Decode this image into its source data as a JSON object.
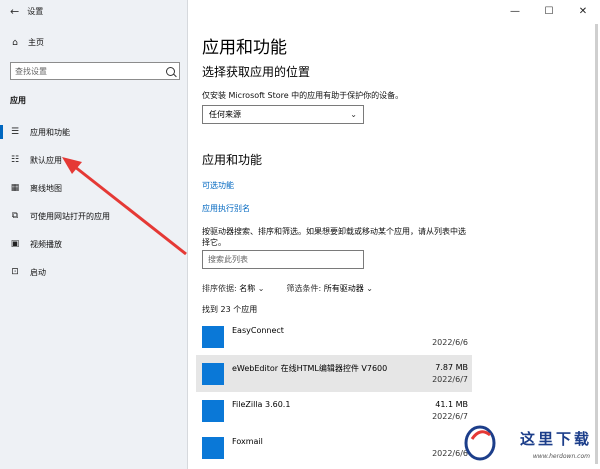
{
  "window": {
    "title": "设置",
    "controls": {
      "minimize": "—",
      "maximize": "☐",
      "close": "✕"
    }
  },
  "sidebar": {
    "home_label": "主页",
    "search_placeholder": "查找设置",
    "section_label": "应用",
    "items": [
      {
        "label": "应用和功能",
        "icon": "apps-list-icon",
        "active": true
      },
      {
        "label": "默认应用",
        "icon": "default-apps-icon",
        "active": false
      },
      {
        "label": "离线地图",
        "icon": "map-icon",
        "active": false
      },
      {
        "label": "可使用网站打开的应用",
        "icon": "website-apps-icon",
        "active": false
      },
      {
        "label": "视频播放",
        "icon": "video-icon",
        "active": false
      },
      {
        "label": "启动",
        "icon": "startup-icon",
        "active": false
      }
    ]
  },
  "main": {
    "page_title": "应用和功能",
    "install_section": {
      "title": "选择获取应用的位置",
      "description": "仅安装 Microsoft Store 中的应用有助于保护你的设备。",
      "dropdown_value": "任何来源"
    },
    "apps_section": {
      "title": "应用和功能",
      "link_optional": "可选功能",
      "link_alias": "应用执行别名",
      "description": "按驱动器搜索、排序和筛选。如果想要卸载或移动某个应用，请从列表中选择它。",
      "search_placeholder": "搜索此列表",
      "sort_label": "排序依据:",
      "sort_value": "名称",
      "filter_label": "筛选条件:",
      "filter_value": "所有驱动器",
      "count_text": "找到 23 个应用",
      "apps": [
        {
          "name": "EasyConnect",
          "size": "",
          "date": "2022/6/6",
          "selected": false
        },
        {
          "name": "eWebEditor 在线HTML编辑器控件 V7600",
          "size": "7.87 MB",
          "date": "2022/6/7",
          "selected": true
        },
        {
          "name": "FileZilla 3.60.1",
          "size": "41.1 MB",
          "date": "2022/6/7",
          "selected": false
        },
        {
          "name": "Foxmail",
          "size": "",
          "date": "2022/6/6",
          "selected": false
        }
      ]
    }
  },
  "watermark": {
    "text": "这里下载",
    "url": "www.herdown.com"
  },
  "colors": {
    "accent": "#0067c0",
    "app_icon": "#0a78d7",
    "sidebar_bg": "#eef1f5",
    "annotation_red": "#e53935"
  }
}
